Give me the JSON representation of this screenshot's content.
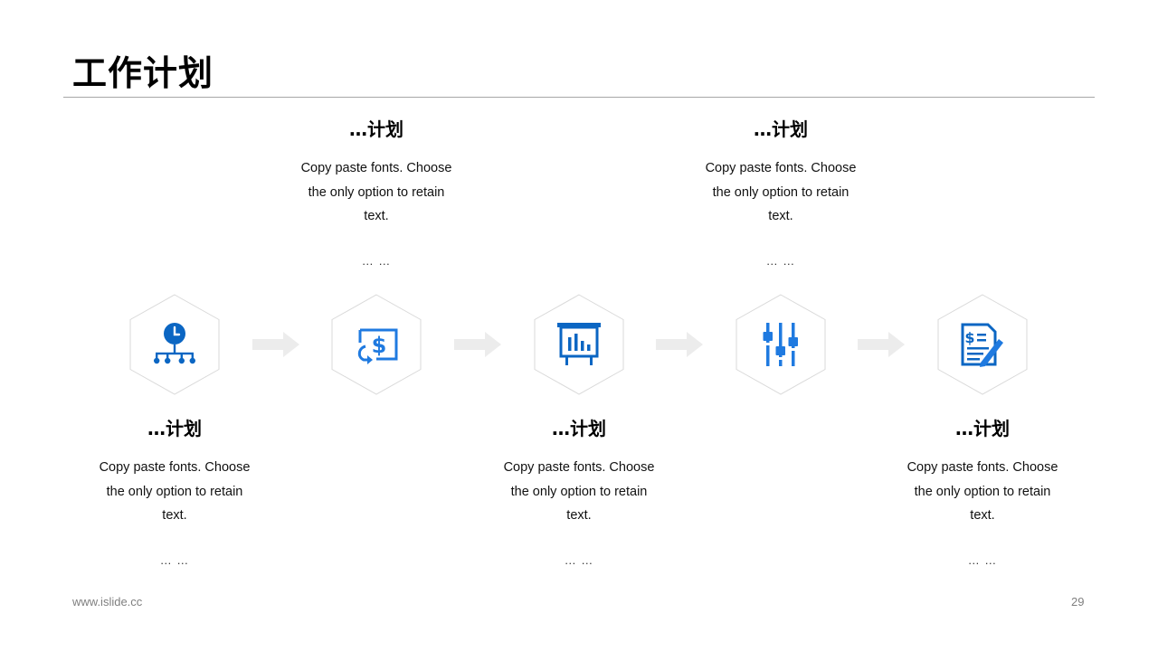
{
  "slide": {
    "title": "工作计划",
    "footer_url": "www.islide.cc",
    "page_number": "29"
  },
  "colors": {
    "accent": "#1f7ae0",
    "accent_dark": "#0b66c3",
    "hex_border": "#d9d9d9",
    "arrow": "#ececec"
  },
  "steps": [
    {
      "icon": "clock-hierarchy-icon",
      "heading": "…计划",
      "text_line1": "Copy paste fonts. Choose",
      "text_line2": "the only option to retain",
      "text_line3": "text.",
      "ellipsis": "… …",
      "position": "below"
    },
    {
      "icon": "money-exchange-icon",
      "heading": "…计划",
      "text_line1": "Copy paste fonts. Choose",
      "text_line2": "the only option to retain",
      "text_line3": "text.",
      "ellipsis": "… …",
      "position": "above"
    },
    {
      "icon": "presentation-chart-icon",
      "heading": "…计划",
      "text_line1": "Copy paste fonts. Choose",
      "text_line2": "the only option to retain",
      "text_line3": "text.",
      "ellipsis": "… …",
      "position": "below"
    },
    {
      "icon": "sliders-icon",
      "heading": "…计划",
      "text_line1": "Copy paste fonts. Choose",
      "text_line2": "the only option to retain",
      "text_line3": "text.",
      "ellipsis": "… …",
      "position": "above"
    },
    {
      "icon": "invoice-sign-icon",
      "heading": "…计划",
      "text_line1": "Copy paste fonts. Choose",
      "text_line2": "the only option to retain",
      "text_line3": "text.",
      "ellipsis": "… …",
      "position": "below"
    }
  ]
}
